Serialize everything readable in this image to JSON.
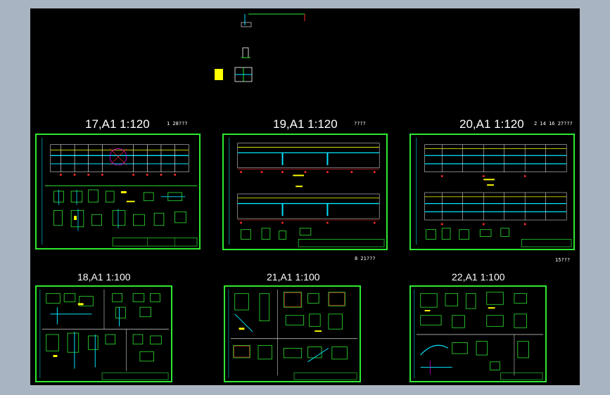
{
  "colors": {
    "background": "#a9b4c2",
    "canvas": "#000000",
    "frame": "#2ee832",
    "cyan": "#00e5ff",
    "red": "#ff2a2a",
    "yellow": "#ffff00",
    "white": "#ffffff",
    "magenta": "#ff00ff"
  },
  "sheets": {
    "s17": {
      "title": "17,A1  1:120",
      "note": "1   28???"
    },
    "s19": {
      "title": "19,A1  1:120",
      "note": "????",
      "note_bottom": "8   21???"
    },
    "s20": {
      "title": "20,A1  1:120",
      "note": "2   14 16 27???",
      "note_bottom": "15???"
    },
    "s18": {
      "title": "18,A1  1:100"
    },
    "s21": {
      "title": "21,A1  1:100"
    },
    "s22": {
      "title": "22,A1  1:100"
    }
  }
}
